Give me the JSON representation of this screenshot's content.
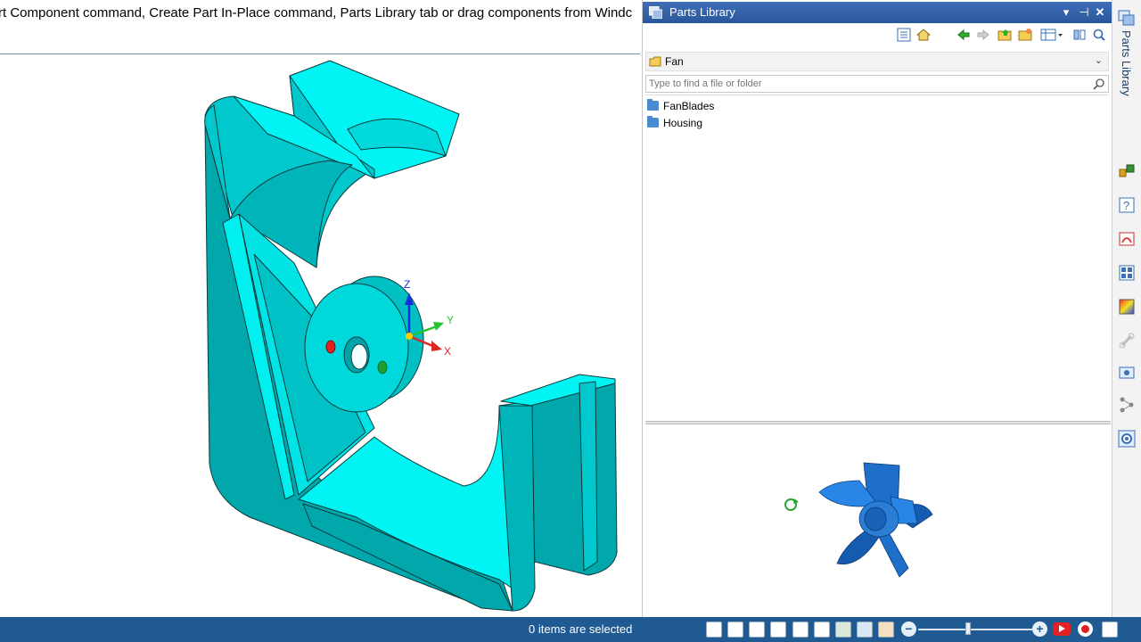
{
  "prompt": {
    "text": "rt Component command, Create Part In-Place command, Parts Library tab or drag components from Windc"
  },
  "axes": {
    "z": "Z",
    "y": "Y",
    "x": "X"
  },
  "parts_library": {
    "title": "Parts Library",
    "folder": "Fan",
    "search_placeholder": "Type to find a file or folder",
    "items": [
      {
        "label": "FanBlades"
      },
      {
        "label": "Housing"
      }
    ],
    "side_tab": "Parts Library"
  },
  "status": {
    "selection_text": "0 items are selected"
  },
  "colors": {
    "part_light": "#00f4f4",
    "part_mid": "#00c8cc",
    "part_dark": "#009ea3",
    "titlebar": "#2a579b",
    "statusbar": "#1f5a93",
    "fan_blue": "#1e6fc9"
  }
}
